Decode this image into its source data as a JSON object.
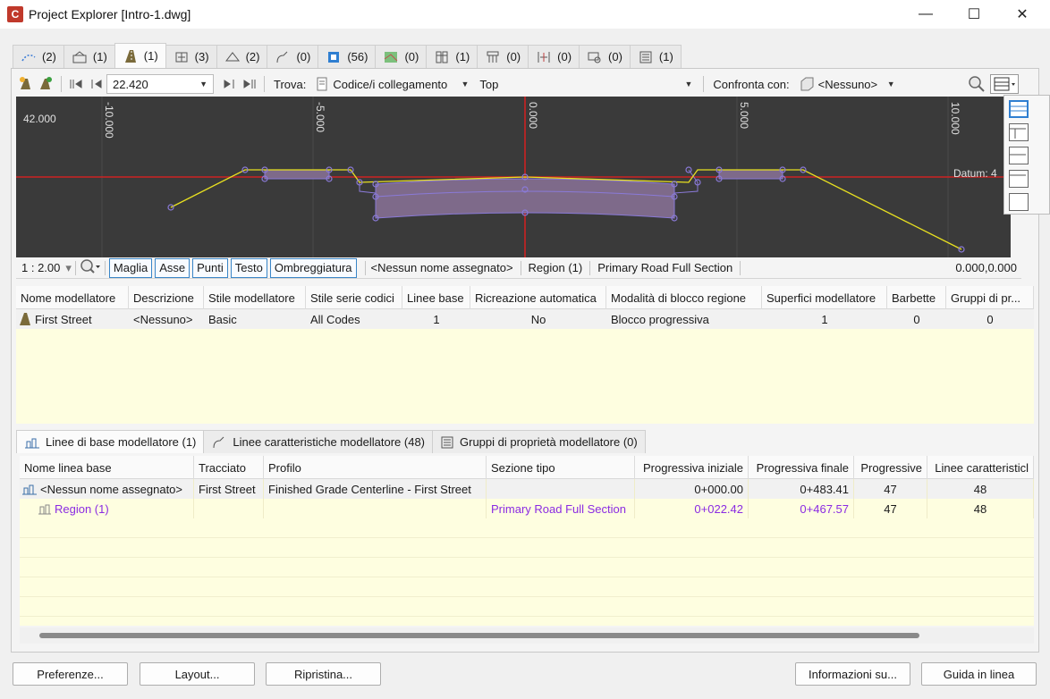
{
  "window": {
    "title": "Project Explorer [Intro-1.dwg]",
    "app_badge": "C",
    "minimize": "—",
    "maximize": "☐",
    "close": "✕"
  },
  "tabs": [
    {
      "icon": "alignment-icon",
      "count": "(2)"
    },
    {
      "icon": "profile-icon",
      "count": "(1)"
    },
    {
      "icon": "corridor-icon",
      "count": "(1)"
    },
    {
      "icon": "assembly-icon",
      "count": "(3)"
    },
    {
      "icon": "surface-icon",
      "count": "(2)"
    },
    {
      "icon": "feature-line-icon",
      "count": "(0)"
    },
    {
      "icon": "point-icon",
      "count": "(56)"
    },
    {
      "icon": "parcel-icon",
      "count": "(0)"
    },
    {
      "icon": "pipe-network-icon",
      "count": "(1)"
    },
    {
      "icon": "pressure-network-icon",
      "count": "(0)"
    },
    {
      "icon": "sample-line-icon",
      "count": "(0)"
    },
    {
      "icon": "view-frame-icon",
      "count": "(0)"
    },
    {
      "icon": "data-shortcut-icon",
      "count": "(1)"
    }
  ],
  "toolbar": {
    "station_value": "22.420",
    "find_label": "Trova:",
    "find_value": "Codice/i collegamento",
    "code_value": "Top",
    "compare_label": "Confronta con:",
    "compare_value": "<Nessuno>"
  },
  "viewer": {
    "elevation_label": "42.000",
    "datum_label": "Datum: 4",
    "ticks": [
      "-10.000",
      "-5.000",
      "0.000",
      "5.000",
      "10.000"
    ]
  },
  "viewbar": {
    "scale": "1 : 2.00",
    "buttons": [
      "Maglia",
      "Asse",
      "Punti",
      "Testo",
      "Ombreggiatura"
    ],
    "name": "<Nessun nome assegnato>",
    "region": "Region (1)",
    "assembly": "Primary Road Full Section",
    "coords": "0.000,0.000"
  },
  "corridor_grid": {
    "headers": [
      "Nome modellatore",
      "Descrizione",
      "Stile modellatore",
      "Stile serie codici",
      "Linee base",
      "Ricreazione automatica",
      "Modalità di blocco regione",
      "Superfici modellatore",
      "Barbette",
      "Gruppi di pr..."
    ],
    "row": [
      "First Street",
      "<Nessuno>",
      "Basic",
      "All Codes",
      "1",
      "No",
      "Blocco progressiva",
      "1",
      "0",
      "0"
    ]
  },
  "subtabs": [
    {
      "label": "Linee di base modellatore (1)"
    },
    {
      "label": "Linee caratteristiche modellatore (48)"
    },
    {
      "label": "Gruppi di proprietà modellatore (0)"
    }
  ],
  "baseline_grid": {
    "headers": [
      "Nome linea base",
      "Tracciato",
      "Profilo",
      "Sezione tipo",
      "Progressiva iniziale",
      "Progressiva finale",
      "Progressive",
      "Linee caratteristicl"
    ],
    "row1": [
      "<Nessun nome assegnato>",
      "First Street",
      "Finished Grade Centerline - First Street",
      "",
      "0+000.00",
      "0+483.41",
      "47",
      "48"
    ],
    "row2": [
      "Region (1)",
      "",
      "",
      "Primary Road Full Section",
      "0+022.42",
      "0+467.57",
      "47",
      "48"
    ]
  },
  "buttons": {
    "preferences": "Preferenze...",
    "layout": "Layout...",
    "restore": "Ripristina...",
    "about": "Informazioni su...",
    "help": "Guida in linea"
  },
  "colors": {
    "accent": "#3a86c8",
    "region": "#8a2be2",
    "viewer_bg": "#3a3a3a",
    "grid_bg": "#fefee0"
  }
}
